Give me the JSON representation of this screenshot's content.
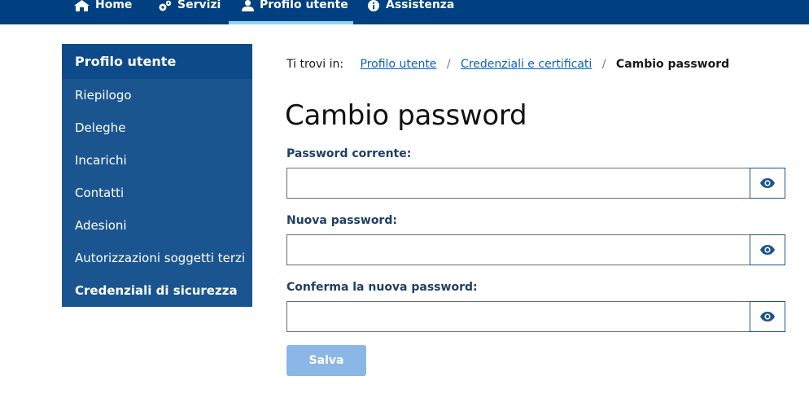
{
  "nav": {
    "items": [
      {
        "label": "Home",
        "icon": "home-icon"
      },
      {
        "label": "Servizi",
        "icon": "cogs-icon"
      },
      {
        "label": "Profilo utente",
        "icon": "user-icon"
      },
      {
        "label": "Assistenza",
        "icon": "info-icon"
      }
    ],
    "active": "Profilo utente"
  },
  "sidebar": {
    "title": "Profilo utente",
    "items": [
      {
        "label": "Riepilogo"
      },
      {
        "label": "Deleghe"
      },
      {
        "label": "Incarichi"
      },
      {
        "label": "Contatti"
      },
      {
        "label": "Adesioni"
      },
      {
        "label": "Autorizzazioni soggetti terzi"
      },
      {
        "label": "Credenziali di sicurezza"
      }
    ],
    "active": "Credenziali di sicurezza"
  },
  "breadcrumb": {
    "label": "Ti trovi in:",
    "items": [
      {
        "label": "Profilo utente"
      },
      {
        "label": "Credenziali e certificati"
      },
      {
        "label": "Cambio password"
      }
    ]
  },
  "form": {
    "title": "Cambio password",
    "fields": [
      {
        "label": "Password corrente:",
        "value": "",
        "placeholder": ""
      },
      {
        "label": "Nuova password:",
        "value": "",
        "placeholder": ""
      },
      {
        "label": "Conferma la nuova password:",
        "value": "",
        "placeholder": ""
      }
    ],
    "toggle_icon": "eye-icon",
    "submit_label": "Salva",
    "submit_disabled": true
  },
  "colors": {
    "nav_bg": "#004080",
    "nav_active_underline": "#8ad6f5",
    "sidebar_bg": "#1a5590",
    "sidebar_header_bg": "#0d4a8a",
    "link": "#0b63b8",
    "label": "#1f3f66",
    "button_disabled": "#8bb7e6"
  }
}
